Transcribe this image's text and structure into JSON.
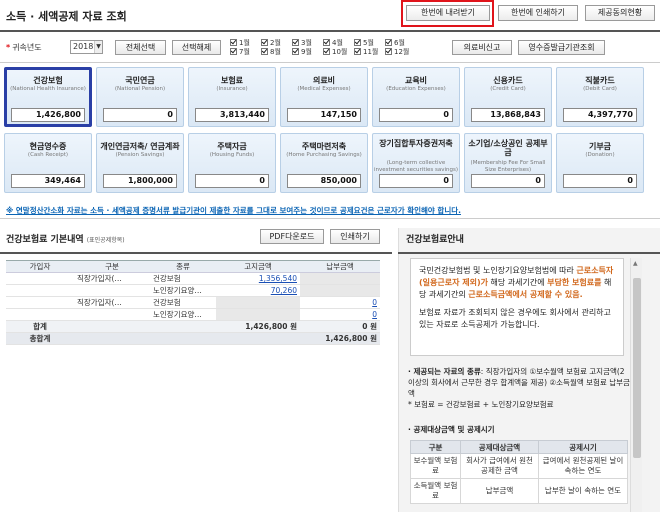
{
  "header": {
    "title": "소득 · 세액공제 자료 조회",
    "download_all": "한번에 내려받기",
    "print_all": "한번에 인쇄하기",
    "consent": "제공동의현황"
  },
  "filter": {
    "label": "귀속년도",
    "year": "2018년",
    "select_all": "전체선택",
    "deselect": "선택해제",
    "months": [
      "1월",
      "2월",
      "3월",
      "4월",
      "5월",
      "6월",
      "7월",
      "8월",
      "9월",
      "10월",
      "11월",
      "12월"
    ],
    "medical_report": "의료비신고",
    "receipt_agency": "영수증발급기관조회"
  },
  "cards": [
    {
      "ko": "건강보험",
      "en": "(National Health Insurance)",
      "value": "1,426,800"
    },
    {
      "ko": "국민연금",
      "en": "(National Pension)",
      "value": "0"
    },
    {
      "ko": "보험료",
      "en": "(Insurance)",
      "value": "3,813,440"
    },
    {
      "ko": "의료비",
      "en": "(Medical Expenses)",
      "value": "147,150"
    },
    {
      "ko": "교육비",
      "en": "(Education Expenses)",
      "value": "0"
    },
    {
      "ko": "신용카드",
      "en": "(Credit Card)",
      "value": "13,868,843"
    },
    {
      "ko": "직불카드",
      "en": "(Debit Card)",
      "value": "4,397,770"
    },
    {
      "ko": "현금영수증",
      "en": "(Cash Receipt)",
      "value": "349,464"
    },
    {
      "ko": "개인연금저축/ 연금계좌",
      "en": "(Pension Savings)",
      "value": "1,800,000"
    },
    {
      "ko": "주택자금",
      "en": "(Housing Funds)",
      "value": "0"
    },
    {
      "ko": "주택마련저축",
      "en": "(Home Purchasing Savings)",
      "value": "850,000"
    },
    {
      "ko": "장기집합투자증권저축",
      "en": "(Long-term collective investment securities savings)",
      "value": "0"
    },
    {
      "ko": "소기업/소상공인 공제부금",
      "en": "(Membership Fee For Small Size Enterprises)",
      "value": "0"
    },
    {
      "ko": "기부금",
      "en": "(Donation)",
      "value": "0"
    }
  ],
  "notice": "※ 연말정산간소화 자료는 소득 · 세액공제 증명서류 발급기관이 제출한 자료를 그대로 보여주는 것이므로 공제요건은 근로자가 확인해야 합니다.",
  "detail": {
    "title": "건강보험료 기본내역",
    "subtitle": "(표인공제항목)",
    "pdf": "PDF다운로드",
    "print": "인쇄하기",
    "headers": [
      "가입자",
      "구분",
      "종류",
      "고지금액",
      "납부금액"
    ],
    "rows": [
      {
        "type": "직장가입자(…",
        "kind": "건강보험",
        "notice": "1,356,540",
        "paid": ""
      },
      {
        "type": "",
        "kind": "노인장기요양…",
        "notice": "70,260",
        "paid": ""
      },
      {
        "type": "직장가입자(…",
        "kind": "건강보험",
        "notice": "",
        "paid": "0"
      },
      {
        "type": "",
        "kind": "노인장기요양…",
        "notice": "",
        "paid": "0"
      }
    ],
    "subtotal_label": "합계",
    "subtotal_notice": "1,426,800 원",
    "subtotal_paid": "0 원",
    "total_label": "총합계",
    "total_value": "1,426,800 원"
  },
  "guide": {
    "title": "건강보험료안내",
    "info_1": "국민건강보험법 및 노인장기요양보험법에 따라",
    "info_hl1": "근로소득자(일용근로자 제외)가",
    "info_2": "해당 과세기간에",
    "info_hl2": "부담한 보험료를",
    "info_3": "해당 과세기간의",
    "info_hl3": "근로소득금액에서 공제할 수 있음.",
    "info_4": "보험료 자료가 조회되지 않은 경우에도 회사에서 관리하고 있는 자료로 소득공제가 가능합니다.",
    "item_title": "· 제공되는 자료의 종류",
    "item_text": ": 직장가입자의 ①보수월액 보험료 고지금액(2 이상의 회사에서 근무한 경우 합계액을 제공) ②소득월액 보험료 납부금액",
    "formula": "* 보험료 = 건강보험료 + 노인장기요양보험료",
    "timing_title": "· 공제대상금액 및 공제시기",
    "table_headers": [
      "구분",
      "공제대상금액",
      "공제시기"
    ],
    "table_rows": [
      [
        "보수월액 보험료",
        "회사가 급여에서 원천공제한 금액",
        "급여에서 원천공제된 날이 속하는 연도"
      ],
      [
        "소득월액 보험료",
        "납부금액",
        "납부한 날이 속하는 연도"
      ]
    ]
  }
}
